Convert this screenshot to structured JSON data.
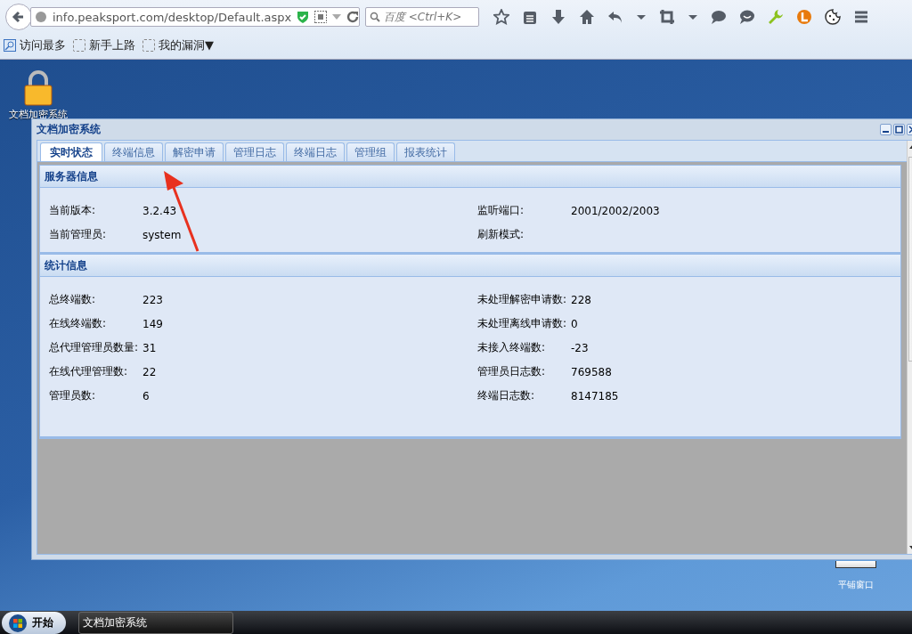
{
  "browser": {
    "url": "info.peaksport.com/desktop/Default.aspx",
    "search": {
      "placeholder": "百度 <Ctrl+K>"
    },
    "bookmarks": [
      {
        "label": "访问最多",
        "kind": "search"
      },
      {
        "label": "新手上路",
        "kind": "folder"
      },
      {
        "label": "我的漏洞▼",
        "kind": "folder"
      }
    ]
  },
  "desktop": {
    "icons": [
      {
        "label": "文档加密系统"
      }
    ],
    "tile_button": {
      "label": "平铺窗口"
    }
  },
  "window": {
    "title": "文档加密系统",
    "tabs": [
      {
        "label": "实时状态",
        "selected": true
      },
      {
        "label": "终端信息",
        "selected": false
      },
      {
        "label": "解密申请",
        "selected": false
      },
      {
        "label": "管理日志",
        "selected": false
      },
      {
        "label": "终端日志",
        "selected": false
      },
      {
        "label": "管理组",
        "selected": false
      },
      {
        "label": "报表统计",
        "selected": false
      }
    ],
    "sections": [
      {
        "title": "服务器信息",
        "fields": [
          {
            "label": "当前版本:",
            "value": "3.2.43"
          },
          {
            "label": "监听端口:",
            "value": "2001/2002/2003"
          },
          {
            "label": "当前管理员:",
            "value": "system"
          },
          {
            "label": "刷新模式:"
          }
        ]
      },
      {
        "title": "统计信息",
        "fields": [
          {
            "label": "总终端数:",
            "value": "223"
          },
          {
            "label": "未处理解密申请数:",
            "value": "228"
          },
          {
            "label": "在线终端数:",
            "value": "149"
          },
          {
            "label": "未处理离线申请数:",
            "value": "0"
          },
          {
            "label": "总代理管理员数量:",
            "value": "31"
          },
          {
            "label": "未接入终端数:",
            "value": "-23"
          },
          {
            "label": "在线代理管理数:",
            "value": "22"
          },
          {
            "label": "管理员日志数:",
            "value": "769588"
          },
          {
            "label": "管理员数:",
            "value": "6"
          },
          {
            "label": "终端日志数:",
            "value": "8147185"
          }
        ]
      }
    ]
  },
  "taskbar": {
    "start": "开始",
    "tasks": [
      {
        "label": "文档加密系统"
      }
    ]
  }
}
